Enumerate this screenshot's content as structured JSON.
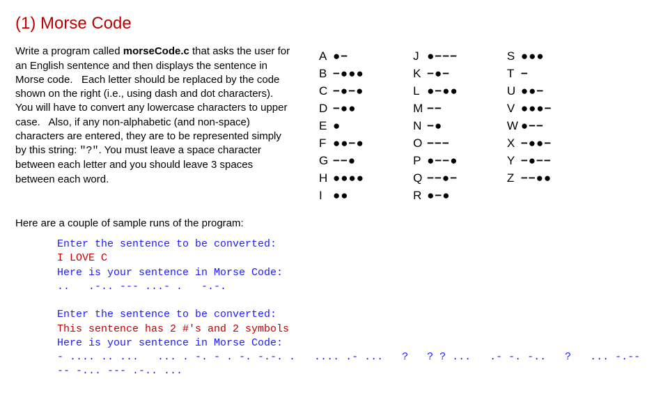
{
  "title": "(1) Morse Code",
  "para_html": "Write a program called <span class='bold'>morseCode.c</span> that asks the user for an English sentence and then displays the sentence in Morse code.&nbsp;&nbsp; Each letter should be replaced by the code shown on the right (i.e., using dash and dot characters).&nbsp; You will have to convert any lowercase characters to upper case.&nbsp;&nbsp; Also, if any non-alphabetic (and non-space) characters are entered, they are to be represented simply by this string: <span class='mono-inline'>\"?\"</span>. You must leave a space character between each letter and you should leave 3 spaces between each word.",
  "subhead": "Here are a couple of sample runs of the program:",
  "chart_data": {
    "type": "table",
    "columns": [
      [
        {
          "letter": "A",
          "code": "●−"
        },
        {
          "letter": "B",
          "code": "−●●●"
        },
        {
          "letter": "C",
          "code": "−●−●"
        },
        {
          "letter": "D",
          "code": "−●●"
        },
        {
          "letter": "E",
          "code": "●"
        },
        {
          "letter": "F",
          "code": "●●−●"
        },
        {
          "letter": "G",
          "code": "−−●"
        },
        {
          "letter": "H",
          "code": "●●●●"
        },
        {
          "letter": "I",
          "code": "●●"
        }
      ],
      [
        {
          "letter": "J",
          "code": "●−−−"
        },
        {
          "letter": "K",
          "code": "−●−"
        },
        {
          "letter": "L",
          "code": "●−●●"
        },
        {
          "letter": "M",
          "code": "−−"
        },
        {
          "letter": "N",
          "code": "−●"
        },
        {
          "letter": "O",
          "code": "−−−"
        },
        {
          "letter": "P",
          "code": "●−−●"
        },
        {
          "letter": "Q",
          "code": "−−●−"
        },
        {
          "letter": "R",
          "code": "●−●"
        }
      ],
      [
        {
          "letter": "S",
          "code": "●●●"
        },
        {
          "letter": "T",
          "code": "−"
        },
        {
          "letter": "U",
          "code": "●●−"
        },
        {
          "letter": "V",
          "code": "●●●−"
        },
        {
          "letter": "W",
          "code": "●−−"
        },
        {
          "letter": "X",
          "code": "−●●−"
        },
        {
          "letter": "Y",
          "code": "−●−−"
        },
        {
          "letter": "Z",
          "code": "−−●●"
        }
      ]
    ]
  },
  "terminal": [
    {
      "cls": "term-blue",
      "text": "Enter the sentence to be converted:"
    },
    {
      "cls": "term-red",
      "text": "I LOVE C"
    },
    {
      "cls": "term-blue",
      "text": "Here is your sentence in Morse Code:"
    },
    {
      "cls": "term-blue",
      "text": "..   .-.. --- ...- .   -.-."
    },
    {
      "cls": "",
      "text": ""
    },
    {
      "cls": "term-blue",
      "text": "Enter the sentence to be converted:"
    },
    {
      "cls": "term-red",
      "text": "This sentence has 2 #'s and 2 symbols"
    },
    {
      "cls": "term-blue",
      "text": "Here is your sentence in Morse Code:"
    },
    {
      "cls": "term-blue",
      "text": "- .... .. ...   ... . -. - . -. -.-. .   .... .- ...   ?   ? ? ...   .- -. -..   ?   ... -.-- -- -... --- .-.. ..."
    }
  ]
}
